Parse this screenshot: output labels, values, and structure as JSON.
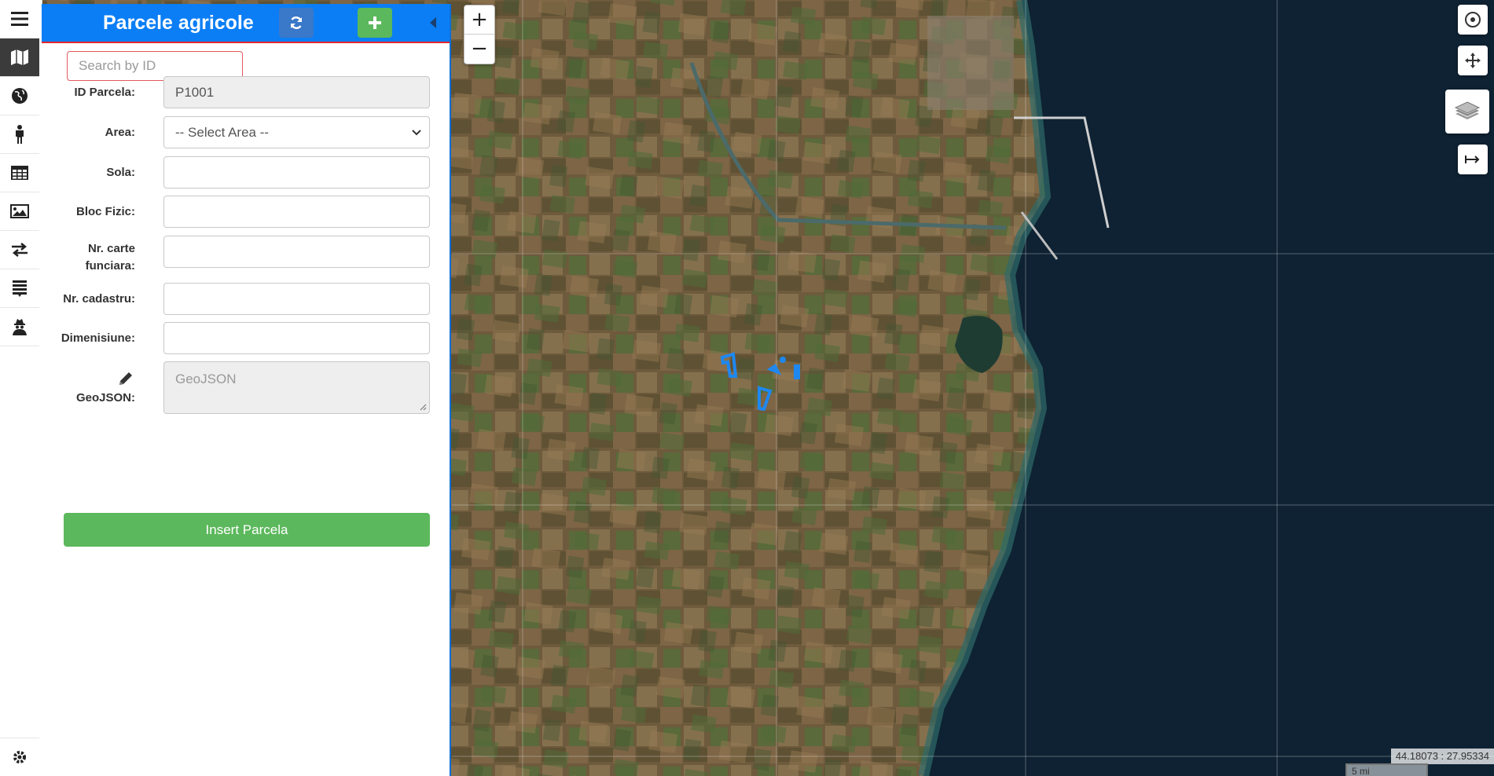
{
  "panel": {
    "title": "Parcele agricole",
    "search_placeholder": "Search by ID",
    "fields": {
      "id_label": "ID Parcela:",
      "id_value": "P1001",
      "area_label": "Area:",
      "area_value": "-- Select Area --",
      "sola_label": "Sola:",
      "bloc_label": "Bloc Fizic:",
      "carte_label_line1": "Nr. carte",
      "carte_label_line2": "funciara:",
      "cadastru_label": "Nr. cadastru:",
      "dim_label": "Dimenisiune:",
      "geojson_label": "GeoJSON:",
      "geojson_placeholder": "GeoJSON"
    },
    "insert_label": "Insert Parcela"
  },
  "map": {
    "zoom_in": "+",
    "zoom_out": "−",
    "coordinates": "44.18073 : 27.95334",
    "scale_label": "5 mi"
  },
  "colors": {
    "header_blue": "#0b7ef5",
    "add_green": "#5cb85c",
    "parcel_blue": "#1e88f0"
  }
}
